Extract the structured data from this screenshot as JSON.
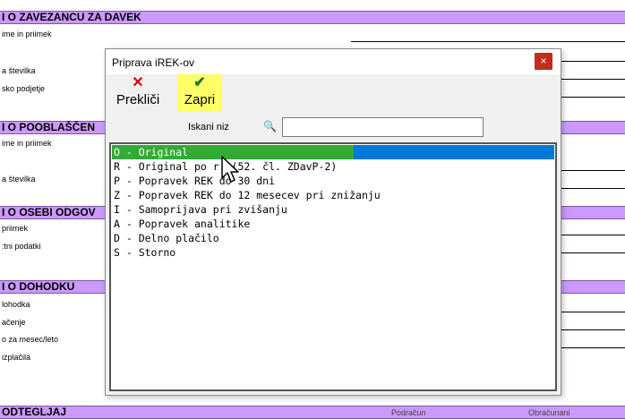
{
  "background": {
    "sections": [
      {
        "title": "I O ZAVEZANCU ZA DAVEK"
      },
      {
        "title": "I O POOBLAŠČEN"
      },
      {
        "title": "I O OSEBI ODGOV"
      },
      {
        "title": "I O DOHODKU"
      },
      {
        "title": "ODTEGLJAJ"
      }
    ],
    "labels": [
      "ime in priimek",
      "a številka",
      "sko podjetje",
      "ime in priimek",
      "a številka",
      "priimek",
      ":tni podatki",
      "lohodka",
      "ačenje",
      "o za mesec/leto",
      "izplačila"
    ],
    "footer": [
      "Podračun",
      "Obračunani"
    ]
  },
  "dialog": {
    "title": "Priprava iREK-ov",
    "close_label": "×",
    "cancel_label": "Prekliči",
    "ok_label": "Zapri",
    "search_label": "Iskani niz",
    "search_value": ""
  },
  "list": [
    {
      "code": "O",
      "text": "O - Original",
      "selected": true
    },
    {
      "code": "R",
      "text": "R - Original po r  (52. čl. ZDavP-2)",
      "selected": false
    },
    {
      "code": "P",
      "text": "P - Popravek REK do 30 dni",
      "selected": false
    },
    {
      "code": "Z",
      "text": "Z - Popravek REK do 12 mesecev pri znižanju",
      "selected": false
    },
    {
      "code": "I",
      "text": "I - Samoprijava pri zvišanju",
      "selected": false
    },
    {
      "code": "A",
      "text": "A - Popravek analitike",
      "selected": false
    },
    {
      "code": "D",
      "text": "D - Delno plačilo",
      "selected": false
    },
    {
      "code": "S",
      "text": "S - Storno",
      "selected": false
    }
  ],
  "colors": {
    "section_bg": "#cc99ff",
    "selection": "#0078d7",
    "highlight": "#33aa33",
    "ok_bg": "#ffff66",
    "close_bg": "#c42b1c"
  }
}
